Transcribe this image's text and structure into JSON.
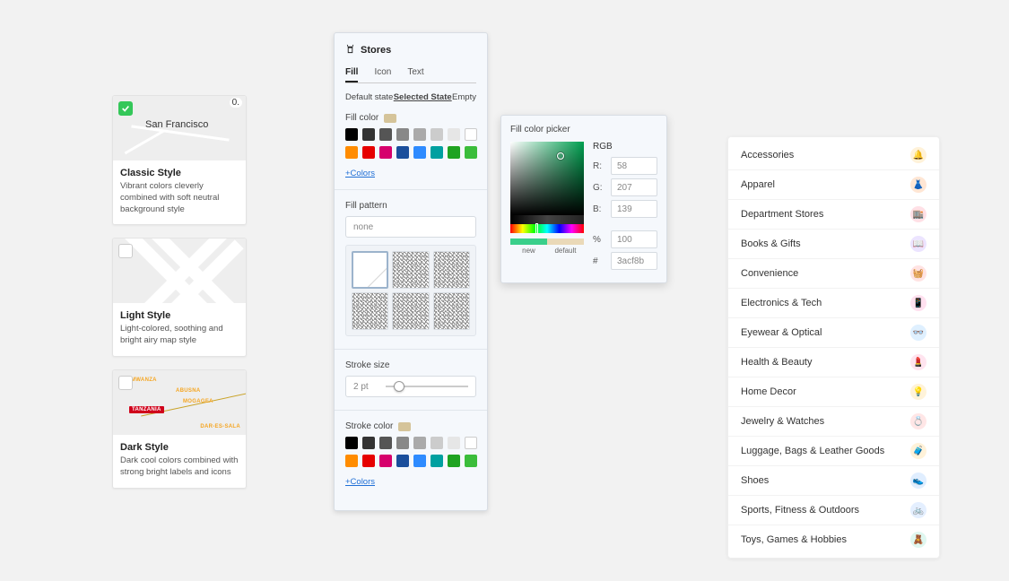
{
  "styleCards": [
    {
      "title": "Classic Style",
      "desc": "Vibrant colors cleverly combined with soft neutral background style",
      "checked": true,
      "thumb": "classic"
    },
    {
      "title": "Light Style",
      "desc": "Light-colored, soothing and bright airy map style",
      "checked": false,
      "thumb": "light"
    },
    {
      "title": "Dark Style",
      "desc": "Dark cool colors combined with strong bright labels and icons",
      "checked": false,
      "thumb": "dark"
    }
  ],
  "editor": {
    "heading": "Stores",
    "tabs_primary": {
      "fill": "Fill",
      "icon": "Icon",
      "text": "Text",
      "active": "fill"
    },
    "tabs_state": {
      "default": "Default state",
      "selected": "Selected State",
      "empty": "Empty",
      "active": "selected"
    },
    "fill_color_label": "Fill color",
    "fill_color_current": "#d5c49a",
    "palette_row1": [
      "#000000",
      "#333333",
      "#555555",
      "#888888",
      "#aaaaaa",
      "#cccccc",
      "#e6e6e6",
      "#ffffff"
    ],
    "palette_row2": [
      "#ff8c00",
      "#e60000",
      "#d6006c",
      "#1b4f9c",
      "#2e8bff",
      "#00a0a0",
      "#1fa321",
      "#3bbd3b"
    ],
    "more_colors": "+Colors",
    "fill_pattern_label": "Fill pattern",
    "pattern_value": "none",
    "stroke_size_label": "Stroke size",
    "stroke_size_value": "2 pt",
    "stroke_color_label": "Stroke color",
    "stroke_color_current": "#d5c49a"
  },
  "picker": {
    "title": "Fill color picker",
    "rgb_label": "RGB",
    "r_label": "R:",
    "r_value": "58",
    "g_label": "G:",
    "g_value": "207",
    "b_label": "B:",
    "b_value": "139",
    "pct_label": "%",
    "pct_value": "100",
    "hex_label": "#",
    "hex_value": "3acf8b",
    "new_label": "new",
    "default_label": "default",
    "new_color": "#3acf8b",
    "default_color": "#ead9b8"
  },
  "categories": [
    {
      "label": "Accessories",
      "icon": "bell-icon",
      "glyph": "🔔",
      "bg": "#fff2d9"
    },
    {
      "label": "Apparel",
      "icon": "dress-icon",
      "glyph": "👗",
      "bg": "#ffe6d4"
    },
    {
      "label": "Department Stores",
      "icon": "bag-icon",
      "glyph": "🏬",
      "bg": "#ffe0e6"
    },
    {
      "label": "Books & Gifts",
      "icon": "book-icon",
      "glyph": "📖",
      "bg": "#ece4ff"
    },
    {
      "label": "Convenience",
      "icon": "basket-icon",
      "glyph": "🧺",
      "bg": "#ffe3e3"
    },
    {
      "label": "Electronics & Tech",
      "icon": "phone-icon",
      "glyph": "📱",
      "bg": "#ffe0ef"
    },
    {
      "label": "Eyewear & Optical",
      "icon": "glasses-icon",
      "glyph": "👓",
      "bg": "#dff0ff"
    },
    {
      "label": "Health & Beauty",
      "icon": "lipstick-icon",
      "glyph": "💄",
      "bg": "#ffe4ef"
    },
    {
      "label": "Home Decor",
      "icon": "lamp-icon",
      "glyph": "💡",
      "bg": "#fff3d9"
    },
    {
      "label": "Jewelry & Watches",
      "icon": "ring-icon",
      "glyph": "💍",
      "bg": "#ffe6e6"
    },
    {
      "label": "Luggage, Bags & Leather Goods",
      "icon": "luggage-icon",
      "glyph": "🧳",
      "bg": "#fff2d9"
    },
    {
      "label": "Shoes",
      "icon": "shoe-icon",
      "glyph": "👟",
      "bg": "#e0eeff"
    },
    {
      "label": "Sports, Fitness & Outdoors",
      "icon": "bike-icon",
      "glyph": "🚲",
      "bg": "#e4efff"
    },
    {
      "label": "Toys, Games & Hobbies",
      "icon": "toy-icon",
      "glyph": "🧸",
      "bg": "#dff7f0"
    }
  ]
}
